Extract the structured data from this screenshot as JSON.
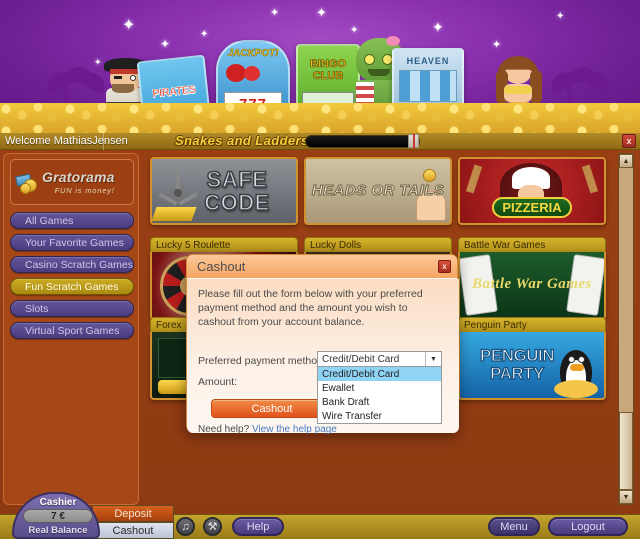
{
  "banner": {
    "characters": [
      {
        "name": "pirate",
        "label": ""
      },
      {
        "name": "pirates-scratch-card",
        "label": "PIRATES"
      },
      {
        "name": "jackpot-slot-machine",
        "label": "JACKPOT!"
      },
      {
        "name": "bingo-club-card",
        "label": "BINGO CLUB"
      },
      {
        "name": "zombie",
        "label": ""
      },
      {
        "name": "heaven-slot-machine",
        "label": "HEAVEN"
      },
      {
        "name": "mermaid",
        "label": ""
      }
    ]
  },
  "topbar": {
    "welcome": "Welcome MathiasJensen",
    "game_title": "Snakes and Ladders",
    "close_label": "x"
  },
  "sidebar": {
    "logo_name": "Gratorama",
    "logo_tagline": "FUN is money!",
    "items": [
      {
        "label": "All Games",
        "active": false
      },
      {
        "label": "Your Favorite Games",
        "active": false
      },
      {
        "label": "Casino Scratch Games",
        "active": false
      },
      {
        "label": "Fun Scratch Games",
        "active": true
      },
      {
        "label": "Slots",
        "active": false
      },
      {
        "label": "Virtual Sport Games",
        "active": false
      }
    ]
  },
  "games": [
    {
      "label": "",
      "art": "SAFE CODE",
      "theme": "art-safe",
      "labeled": false
    },
    {
      "label": "",
      "art": "HEADS OR TAILS",
      "theme": "art-heads",
      "labeled": false
    },
    {
      "label": "",
      "art": "PIZZERIA",
      "theme": "art-pizza",
      "labeled": false
    },
    {
      "label": "Lucky 5 Roulette",
      "art": "",
      "theme": "art-roulette",
      "labeled": true
    },
    {
      "label": "Lucky Dolls",
      "art": "",
      "theme": "art-dolls",
      "labeled": true
    },
    {
      "label": "Battle War Games",
      "art": "Battle War Games",
      "theme": "art-battle",
      "labeled": true
    },
    {
      "label": "Forex",
      "art": "",
      "theme": "art-forex",
      "labeled": true
    },
    {
      "label": "Penguin Party",
      "art": "PENGUIN PARTY",
      "theme": "art-penguin",
      "labeled": true
    }
  ],
  "scrollbar": {
    "up": "▲",
    "down": "▼"
  },
  "modal": {
    "title": "Cashout",
    "close_label": "x",
    "description": "Please fill out the form below with your preferred payment method and the amount you wish to cashout from your account balance.",
    "method_label": "Preferred payment method:",
    "amount_label": "Amount:",
    "selected_method": "Credit/Debit Card",
    "options": [
      "Credit/Debit Card",
      "Ewallet",
      "Bank Draft",
      "Wire Transfer"
    ],
    "submit_label": "Cashout",
    "help_prefix": "Need help? ",
    "help_link": "View the help page"
  },
  "bottom": {
    "cashier_title": "Cashier",
    "cashier_amount": "7 €",
    "cashier_sub": "Real Balance",
    "deposit_label": "Deposit",
    "cashout_label": "Cashout",
    "music_icon": "♫",
    "tools_icon": "⚒",
    "help_label": "Help",
    "menu_label": "Menu",
    "logout_label": "Logout"
  },
  "colors": {
    "brand_orange": "#a64717",
    "accent_gold": "#c3a52d",
    "nav_purple": "#4a3c7e",
    "nav_active": "#ccab22",
    "modal_header": "#f5a461",
    "cashout_button": "#e0521b",
    "link_blue": "#4a79c4",
    "option_highlight": "#8fd4f5"
  }
}
